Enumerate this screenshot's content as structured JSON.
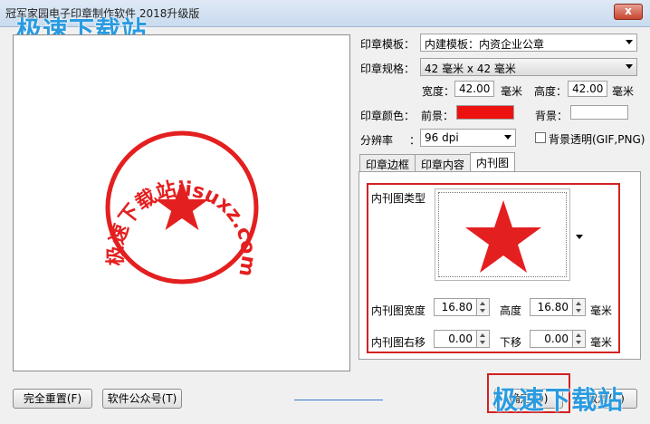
{
  "window": {
    "title": "冠军家园电子印章制作软件 2018升级版",
    "close_label": "x"
  },
  "watermark": {
    "text": "极速下载站"
  },
  "stamp": {
    "ring_text": "极速下载站jisuxz.com",
    "color": "#e41f1f"
  },
  "form": {
    "template_label": "印章模板：",
    "template_value": "内建模板：内资企业公章",
    "size_label": "印章规格：",
    "size_value": "42 毫米  x 42 毫米",
    "width_label": "宽度：",
    "width_value": "42.00",
    "width_unit": "毫米",
    "height_label": "高度：",
    "height_value": "42.00",
    "height_unit": "毫米",
    "color_label": "印章颜色：",
    "fg_label": "前景：",
    "fg_color": "#ee1111",
    "bg_label": "背景：",
    "bg_color": "#ffffff",
    "resolution_label": "分辨率",
    "resolution_colon": "：",
    "resolution_value": "96 dpi",
    "transparent_label": "背景透明(GIF,PNG)"
  },
  "tabs": [
    {
      "label": "印章边框"
    },
    {
      "label": "印章内容"
    },
    {
      "label": "内刊图"
    }
  ],
  "inner_image": {
    "type_label": "内刊图类型",
    "width_label": "内刊图宽度",
    "width_value": "16.80",
    "height_label": "高度",
    "height_value": "16.80",
    "size_unit": "毫米",
    "right_label": "内刊图右移",
    "right_value": "0.00",
    "down_label": "下移",
    "down_value": "0.00",
    "offset_unit": "毫米"
  },
  "buttons": {
    "reset": "完全重置(F)",
    "wechat": "软件公众号(T)",
    "confirm": "确定(O)",
    "cancel": "取消(C)"
  }
}
